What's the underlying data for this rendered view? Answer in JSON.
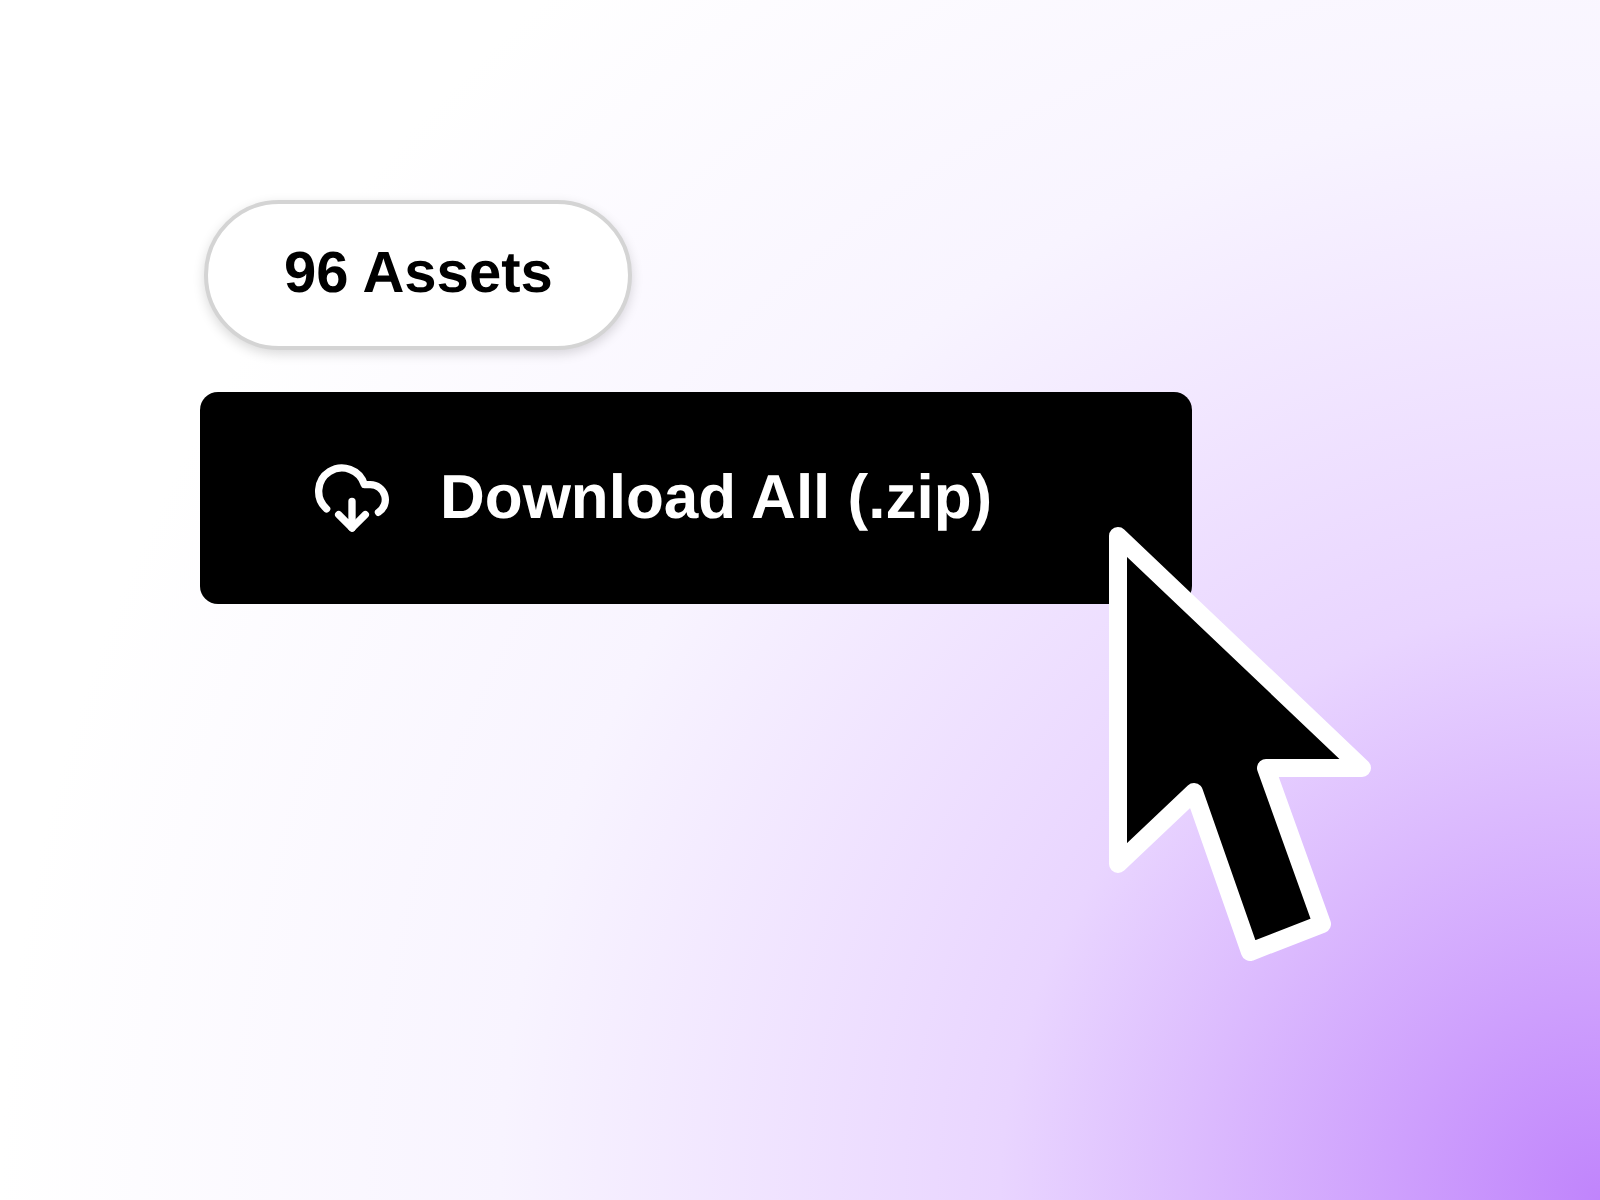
{
  "badge": {
    "label": "96 Assets"
  },
  "download_button": {
    "label": "Download All (.zip)"
  }
}
